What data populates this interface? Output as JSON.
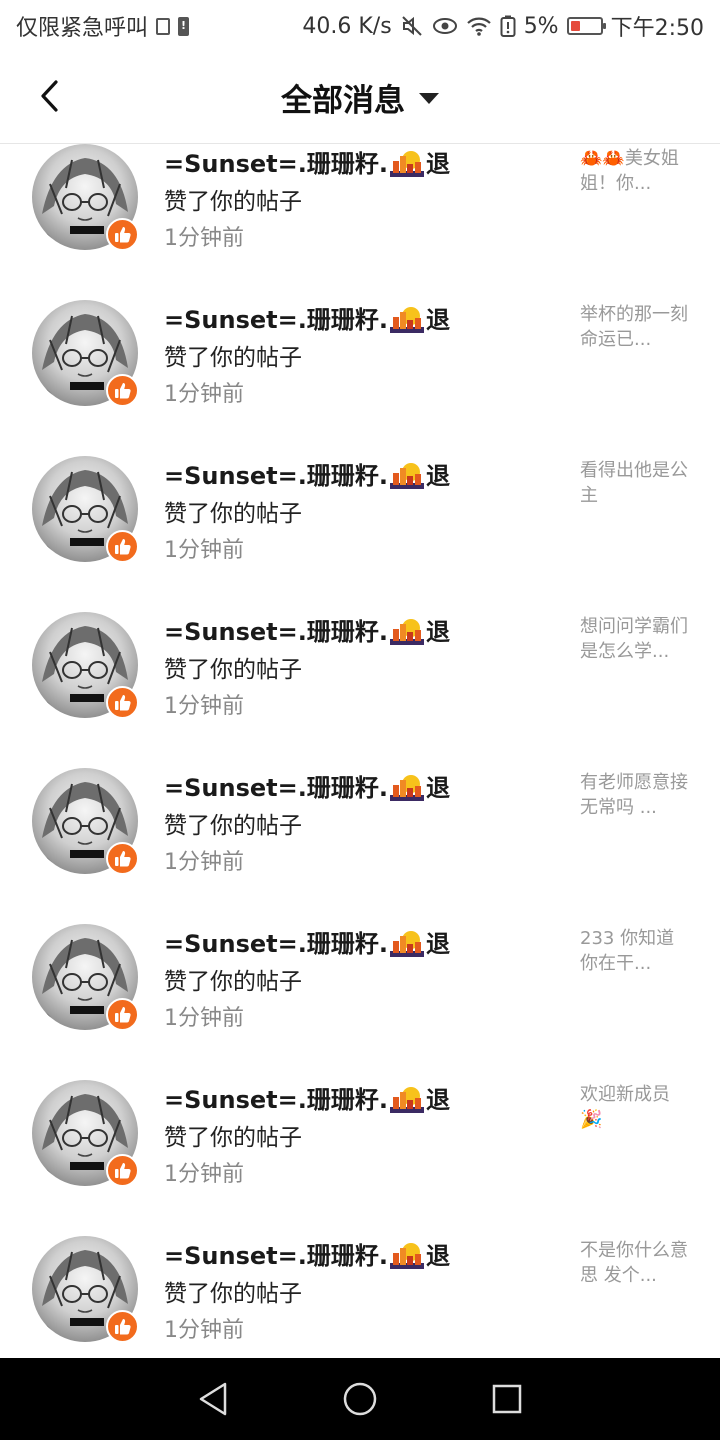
{
  "status_bar": {
    "carrier": "仅限紧急呼叫",
    "net_speed": "40.6 K/s",
    "battery_percent": "5%",
    "time": "下午2:50"
  },
  "header": {
    "title": "全部消息"
  },
  "colors": {
    "accent": "#f26b1d",
    "time_text": "#888888",
    "preview_text": "#999999"
  },
  "notifications": [
    {
      "name": "=Sunset=.珊珊籽.",
      "tail": "退",
      "action": "赞了你的帖子",
      "time": "1分钟前",
      "preview": "🦀🦀美女姐姐！你..."
    },
    {
      "name": "=Sunset=.珊珊籽.",
      "tail": "退",
      "action": "赞了你的帖子",
      "time": "1分钟前",
      "preview": "举杯的那一刻 命运已..."
    },
    {
      "name": "=Sunset=.珊珊籽.",
      "tail": "退",
      "action": "赞了你的帖子",
      "time": "1分钟前",
      "preview": "看得出他是公主"
    },
    {
      "name": "=Sunset=.珊珊籽.",
      "tail": "退",
      "action": "赞了你的帖子",
      "time": "1分钟前",
      "preview": "想问问学霸们是怎么学..."
    },
    {
      "name": "=Sunset=.珊珊籽.",
      "tail": "退",
      "action": "赞了你的帖子",
      "time": "1分钟前",
      "preview": "有老师愿意接无常吗 ..."
    },
    {
      "name": "=Sunset=.珊珊籽.",
      "tail": "退",
      "action": "赞了你的帖子",
      "time": "1分钟前",
      "preview": "233 你知道你在干..."
    },
    {
      "name": "=Sunset=.珊珊籽.",
      "tail": "退",
      "action": "赞了你的帖子",
      "time": "1分钟前",
      "preview": "欢迎新成员🎉"
    },
    {
      "name": "=Sunset=.珊珊籽.",
      "tail": "退",
      "action": "赞了你的帖子",
      "time": "1分钟前",
      "preview": "不是你什么意思 发个..."
    }
  ]
}
